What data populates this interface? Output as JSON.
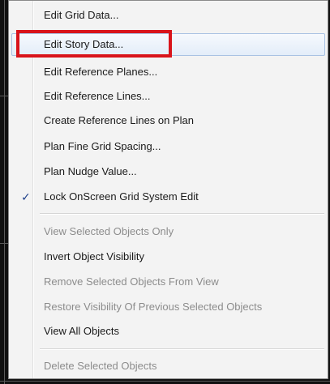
{
  "menu": {
    "items": [
      {
        "label": "Edit Grid Data...",
        "disabled": false
      },
      {
        "label": "Edit Story Data...",
        "disabled": false,
        "hover": true
      },
      {
        "label": "Edit Reference Planes...",
        "disabled": false
      },
      {
        "label": "Edit Reference Lines...",
        "disabled": false
      },
      {
        "label": "Create Reference Lines on Plan",
        "disabled": false
      },
      {
        "label": "Plan Fine Grid Spacing...",
        "disabled": false
      },
      {
        "label": "Plan Nudge Value...",
        "disabled": false
      },
      {
        "label": "Lock OnScreen Grid System Edit",
        "disabled": false,
        "checked": true
      },
      {
        "label": "View Selected Objects Only",
        "disabled": true
      },
      {
        "label": "Invert Object Visibility",
        "disabled": false
      },
      {
        "label": "Remove Selected Objects From View",
        "disabled": true
      },
      {
        "label": "Restore Visibility Of Previous Selected Objects",
        "disabled": true
      },
      {
        "label": "View All Objects",
        "disabled": false
      },
      {
        "label": "Delete Selected Objects",
        "disabled": true
      }
    ],
    "check_glyph": "✓"
  },
  "colors": {
    "highlight_box": "#d9141b",
    "hover_border": "#a9c2e3",
    "disabled_text": "#8c8c8c"
  }
}
